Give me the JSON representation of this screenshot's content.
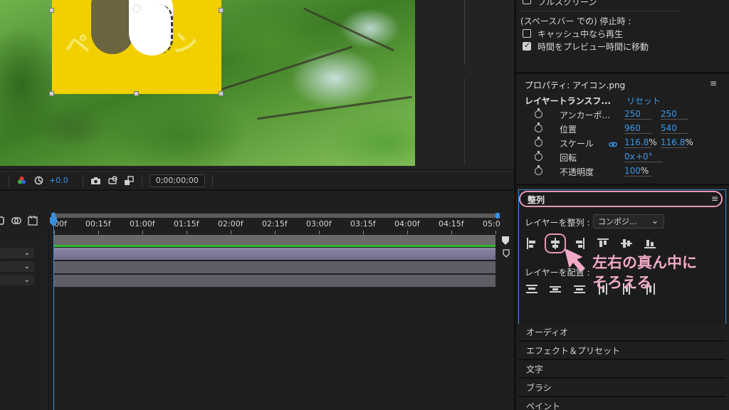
{
  "viewer": {
    "layer_text_1": "ペ",
    "layer_text_2": "ン",
    "toolbar": {
      "exposure_value": "+0.0",
      "timecode": "0;00;00;00"
    }
  },
  "timeline": {
    "ruler_labels": [
      "00f",
      "00:15f",
      "01:00f",
      "01:15f",
      "02:00f",
      "02:15f",
      "03:00f",
      "03:15f",
      "04:00f",
      "04:15f",
      "05:0"
    ],
    "track_count": 3
  },
  "right_panel": {
    "preview": {
      "fullscreen_label": "フルスクリーン",
      "on_spacebar_stop_label": "(スペースバー での) 停止時 :",
      "play_if_cached_label": "キャッシュ中なら再生",
      "play_if_cached_checked": false,
      "move_time_label": "時間をプレビュー時間に移動",
      "move_time_checked": true
    },
    "properties": {
      "title": "プロパティ: アイコン.png",
      "section_label": "レイヤートランスフ...",
      "reset_label": "リセット",
      "rows": [
        {
          "name": "アンカーポ...",
          "v1": "250",
          "v2": "250"
        },
        {
          "name": "位置",
          "v1": "960",
          "v2": "540"
        },
        {
          "name": "スケール",
          "v1": "116.8",
          "v1_unit": "%",
          "v2": "116.8",
          "v2_unit": "%"
        },
        {
          "name": "回転",
          "v1": "0x",
          "v2": "+0°"
        },
        {
          "name": "不透明度",
          "v1": "100",
          "v1_unit": "%"
        }
      ]
    },
    "align": {
      "title": "整列",
      "align_to_label": "レイヤーを整列 :",
      "align_to_value": "コンポジ...",
      "distribute_label": "レイヤーを配置 :",
      "annotation_line1": "左右の真ん中に",
      "annotation_line2": "そろえる"
    },
    "collapsed_panels": [
      "オーディオ",
      "エフェクト＆プリセット",
      "文字",
      "ブラシ",
      "ペイント"
    ]
  },
  "colors": {
    "accent_blue": "#3a97e8",
    "annotation_pink": "#e697b5",
    "layer_yellow": "#f2d000",
    "work_area_green": "#2dbb2d"
  }
}
